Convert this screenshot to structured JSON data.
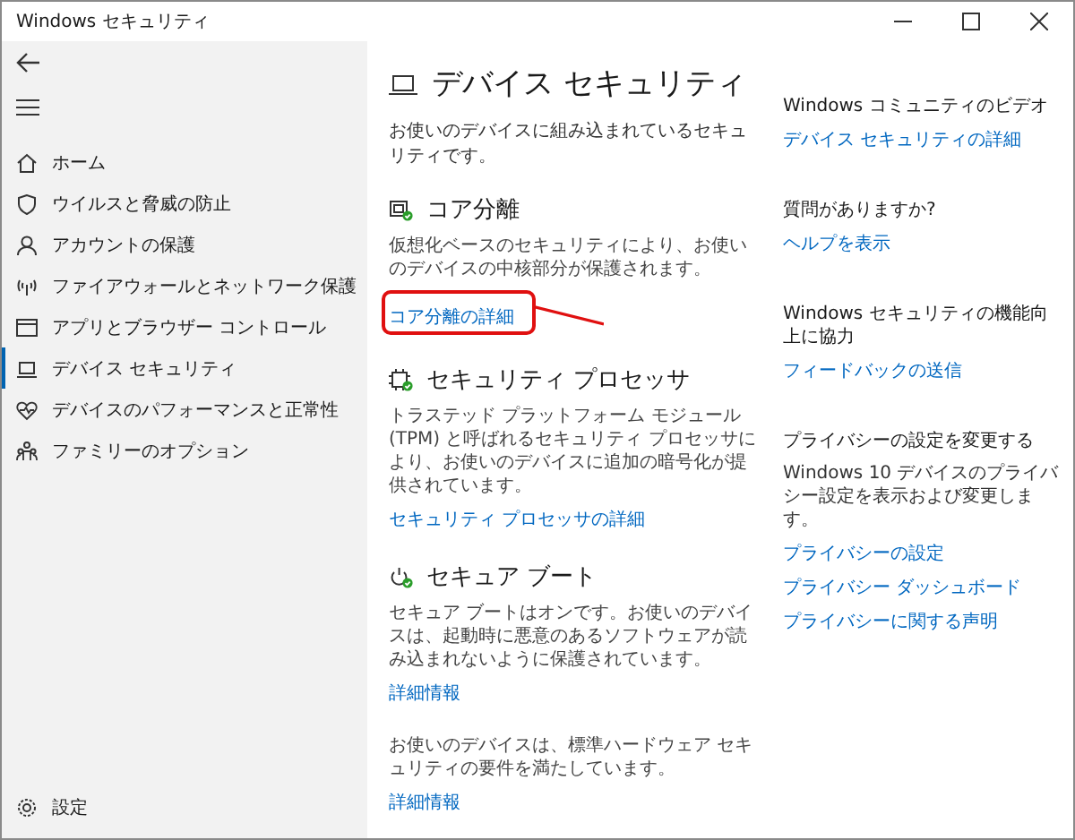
{
  "window": {
    "title": "Windows セキュリティ"
  },
  "sidebar": {
    "items": [
      {
        "label": "ホーム",
        "selected": false
      },
      {
        "label": "ウイルスと脅威の防止",
        "selected": false
      },
      {
        "label": "アカウントの保護",
        "selected": false
      },
      {
        "label": "ファイアウォールとネットワーク保護",
        "selected": false
      },
      {
        "label": "アプリとブラウザー コントロール",
        "selected": false
      },
      {
        "label": "デバイス セキュリティ",
        "selected": true
      },
      {
        "label": "デバイスのパフォーマンスと正常性",
        "selected": false
      },
      {
        "label": "ファミリーのオプション",
        "selected": false
      }
    ],
    "settings": "設定"
  },
  "page": {
    "title": "デバイス セキュリティ",
    "subtitle": "お使いのデバイスに組み込まれているセキュリティです。"
  },
  "sections": [
    {
      "title": "コア分離",
      "description": "仮想化ベースのセキュリティにより、お使いのデバイスの中核部分が保護されます。",
      "link": "コア分離の詳細",
      "highlighted": true
    },
    {
      "title": "セキュリティ プロセッサ",
      "description": "トラステッド プラットフォーム モジュール (TPM) と呼ばれるセキュリティ プロセッサにより、お使いのデバイスに追加の暗号化が提供されています。",
      "link": "セキュリティ プロセッサの詳細",
      "highlighted": false
    },
    {
      "title": "セキュア ブート",
      "description": "セキュア ブートはオンです。お使いのデバイスは、起動時に悪意のあるソフトウェアが読み込まれないように保護されています。",
      "link": "詳細情報",
      "highlighted": false
    },
    {
      "description": "お使いのデバイスは、標準ハードウェア セキュリティの要件を満たしています。",
      "link": "詳細情報",
      "highlighted": false
    }
  ],
  "side_panel": [
    {
      "heading": "Windows コミュニティのビデオ",
      "links": [
        "デバイス セキュリティの詳細"
      ]
    },
    {
      "heading": "質問がありますか?",
      "links": [
        "ヘルプを表示"
      ]
    },
    {
      "heading": "Windows セキュリティの機能向上に協力",
      "links": [
        "フィードバックの送信"
      ]
    },
    {
      "heading": "プライバシーの設定を変更する",
      "text": "Windows 10 デバイスのプライバシー設定を表示および変更します。",
      "links": [
        "プライバシーの設定",
        "プライバシー ダッシュボード",
        "プライバシーに関する声明"
      ]
    }
  ]
}
